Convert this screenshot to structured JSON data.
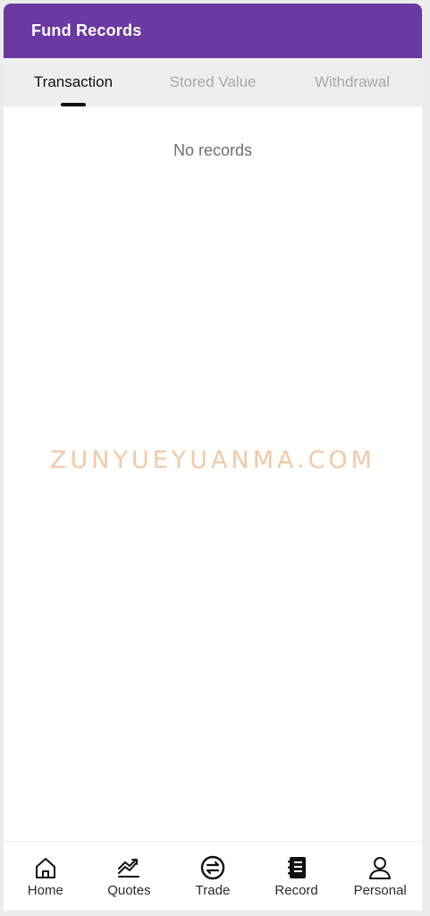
{
  "header": {
    "title": "Fund Records"
  },
  "tabs": [
    {
      "label": "Transaction",
      "active": true
    },
    {
      "label": "Stored Value",
      "active": false
    },
    {
      "label": "Withdrawal",
      "active": false
    }
  ],
  "content": {
    "empty_message": "No records",
    "watermark": "ZUNYUEYUANMA.COM"
  },
  "bottom_nav": [
    {
      "label": "Home",
      "icon": "home-icon"
    },
    {
      "label": "Quotes",
      "icon": "chart-icon"
    },
    {
      "label": "Trade",
      "icon": "exchange-icon"
    },
    {
      "label": "Record",
      "icon": "notebook-icon"
    },
    {
      "label": "Personal",
      "icon": "user-icon"
    }
  ],
  "colors": {
    "header_bg": "#6a3aa2",
    "tab_bar_bg": "#eeeeee",
    "active_tab": "#111111",
    "inactive_tab": "#a8a8a8",
    "watermark": "#f2c9a7"
  }
}
